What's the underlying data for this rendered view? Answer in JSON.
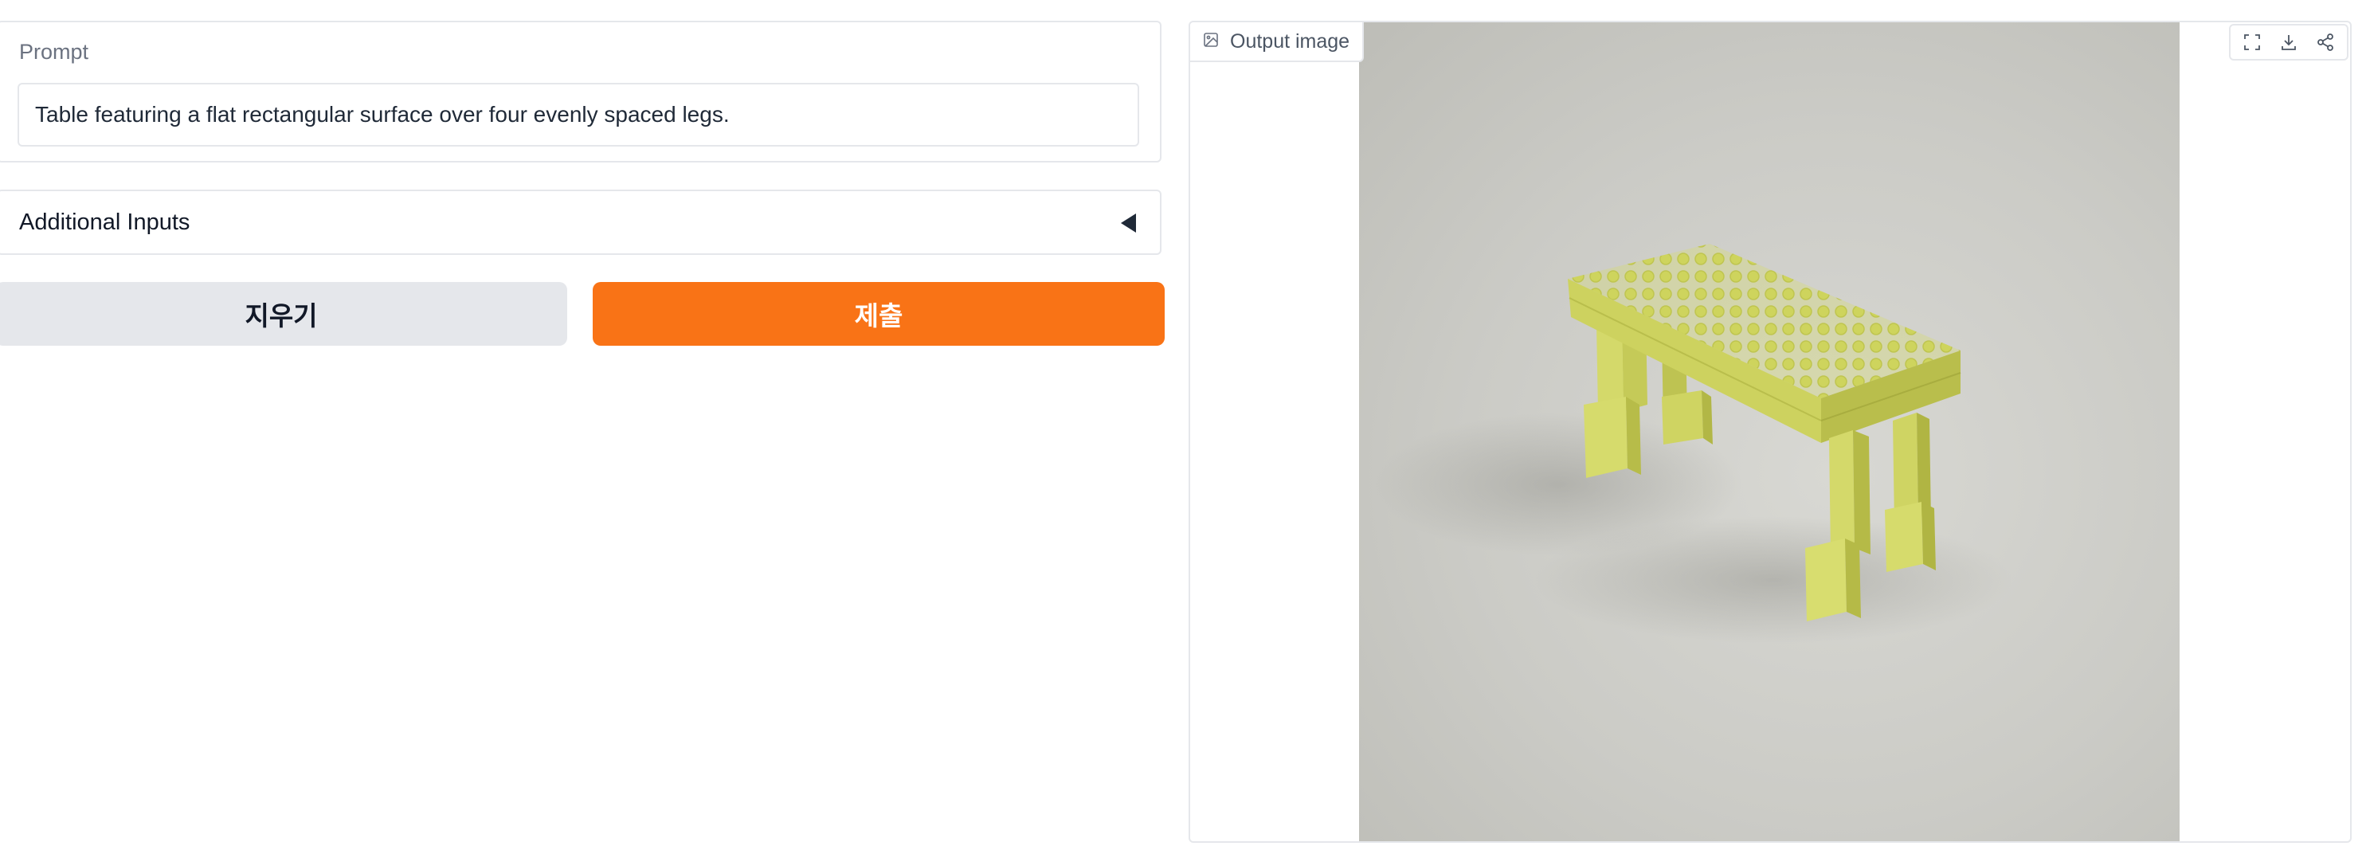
{
  "prompt": {
    "label": "Prompt",
    "value": "Table featuring a flat rectangular surface over four evenly spaced legs."
  },
  "additional_inputs": {
    "label": "Additional Inputs",
    "state": "collapsed",
    "arrow_icon": "triangle-left-icon"
  },
  "buttons": {
    "clear_label": "지우기",
    "submit_label": "제출"
  },
  "output": {
    "label": "Output image",
    "label_icon": "image-icon",
    "tools": [
      "fullscreen-icon",
      "download-icon",
      "share-icon"
    ],
    "image_subject": "yellow-green brick-built table on grey background"
  },
  "colors": {
    "accent": "#f97316",
    "secondary_button": "#e5e7eb",
    "border": "#e5e7eb",
    "brick": "#d4d96a",
    "background_grey": "#c9c9c4"
  }
}
